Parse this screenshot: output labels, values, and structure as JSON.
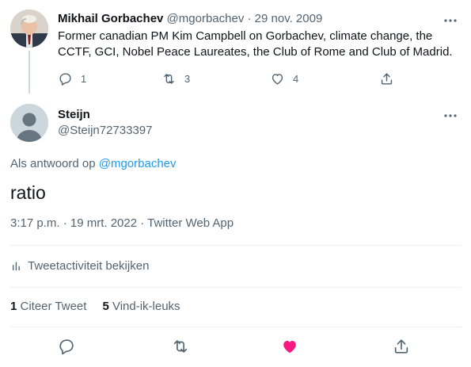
{
  "parent_tweet": {
    "display_name": "Mikhail Gorbachev",
    "handle": "@mgorbachev",
    "separator": "·",
    "date": "29 nov. 2009",
    "text": "Former canadian PM Kim Campbell on Gorbachev, climate change, the CCTF, GCI, Nobel Peace Laureates, the Club of Rome and Club of Madrid.",
    "more_glyph": "•••",
    "actions": {
      "reply_count": "1",
      "retweet_count": "3",
      "like_count": "4"
    }
  },
  "reply_tweet": {
    "display_name": "Steijn",
    "handle": "@Steijn72733397",
    "more_glyph": "•••",
    "reply_to_prefix": "Als antwoord op ",
    "reply_to_handle": "@mgorbachev",
    "text": "ratio",
    "timestamp": "3:17 p.m. · 19 mrt. 2022 · Twitter Web App",
    "activity_label": "Tweetactiviteit bekijken",
    "stats": {
      "quote_count": "1",
      "quote_label": " Citeer Tweet",
      "like_count": "5",
      "like_label": " Vind-ik-leuks"
    }
  },
  "colors": {
    "link": "#1d9bf0",
    "like_active": "#f91880",
    "secondary_text": "#536471",
    "divider": "#eff3f4"
  },
  "icons": {
    "reply": "reply-icon",
    "retweet": "retweet-icon",
    "like": "heart-icon",
    "share": "share-icon",
    "analytics": "bar-chart-icon",
    "more": "more-icon"
  }
}
